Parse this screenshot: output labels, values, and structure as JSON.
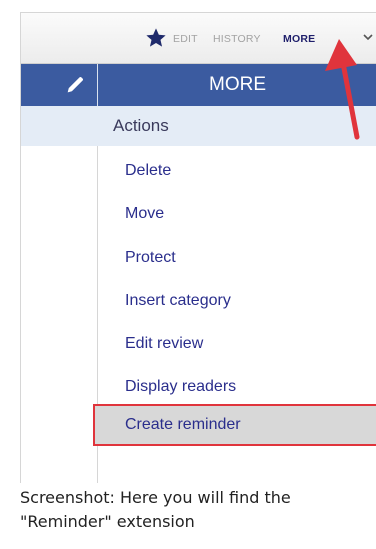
{
  "toolbar": {
    "star_icon": "star-icon",
    "edit_label": "EDIT",
    "history_label": "HISTORY",
    "more_label": "MORE",
    "chevron_icon": "chevron-down-icon"
  },
  "panel": {
    "edit_icon": "pencil-icon",
    "title": "MORE",
    "section_label": "Actions",
    "items": [
      {
        "label": "Delete"
      },
      {
        "label": "Move"
      },
      {
        "label": "Protect"
      },
      {
        "label": "Insert category"
      },
      {
        "label": "Edit review"
      },
      {
        "label": "Display readers"
      },
      {
        "label": "Create reminder",
        "highlighted": true
      }
    ]
  },
  "caption": {
    "text": "Screenshot: Here you will find the \"Reminder\" extension"
  },
  "colors": {
    "header_bg": "#3b5ba0",
    "section_bg": "#e4ecf6",
    "link": "#2a2e8c",
    "highlight_border": "#e0343c",
    "arrow": "#e0343c"
  }
}
